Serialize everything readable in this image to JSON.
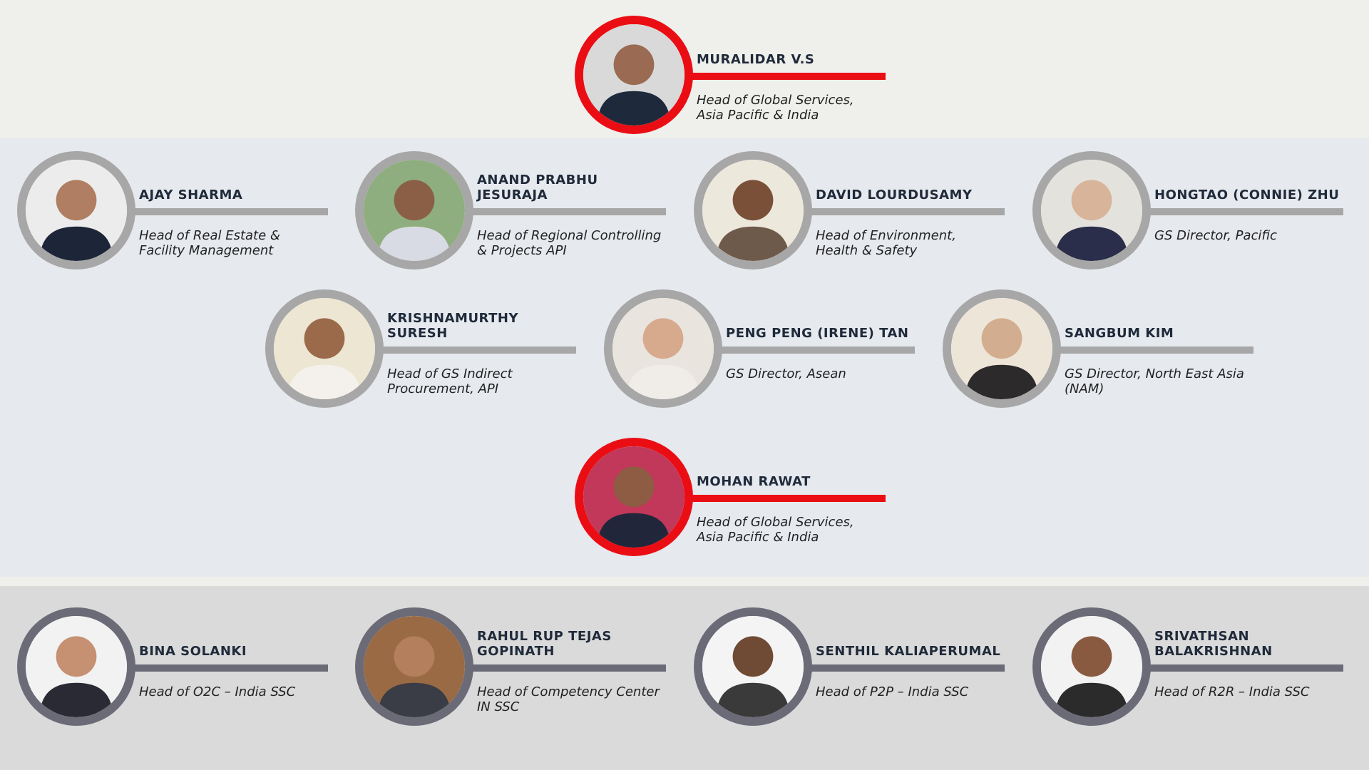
{
  "leader": {
    "name": "MURALIDAR V.S",
    "role": "Head of Global Services,\nAsia Pacific & India"
  },
  "row1": [
    {
      "name": "AJAY SHARMA",
      "role": "Head of Real Estate &\nFacility Management"
    },
    {
      "name": "ANAND PRABHU\nJESURAJA",
      "role": "Head of Regional Controlling\n& Projects API"
    },
    {
      "name": "DAVID LOURDUSAMY",
      "role": "Head of Environment,\nHealth & Safety"
    },
    {
      "name": "HONGTAO (CONNIE) ZHU",
      "role": "GS Director, Pacific"
    }
  ],
  "row2": [
    {
      "name": "KRISHNAMURTHY\nSURESH",
      "role": "Head of GS Indirect\nProcurement, API"
    },
    {
      "name": "PENG PENG (IRENE) TAN",
      "role": "GS Director, Asean"
    },
    {
      "name": "SANGBUM KIM",
      "role": "GS Director, North East Asia\n(NAM)"
    }
  ],
  "second_leader": {
    "name": "MOHAN RAWAT",
    "role": "Head of Global Services,\nAsia Pacific & India"
  },
  "row3": [
    {
      "name": "BINA SOLANKI",
      "role": "Head of O2C – India SSC"
    },
    {
      "name": "RAHUL RUP TEJAS\nGOPINATH",
      "role": "Head of Competency Center\nIN SSC"
    },
    {
      "name": "SENTHIL KALIAPERUMAL",
      "role": "Head of P2P – India SSC"
    },
    {
      "name": "SRIVATHSAN\nBALAKRISHNAN",
      "role": "Head of R2R – India SSC"
    }
  ],
  "colors": {
    "accent": "#ea0e14",
    "ring_grey": "#a7a7a7",
    "ring_dark": "#6b6b78",
    "mid_band": "#e6e9ee",
    "bottom_band": "#dadada"
  }
}
